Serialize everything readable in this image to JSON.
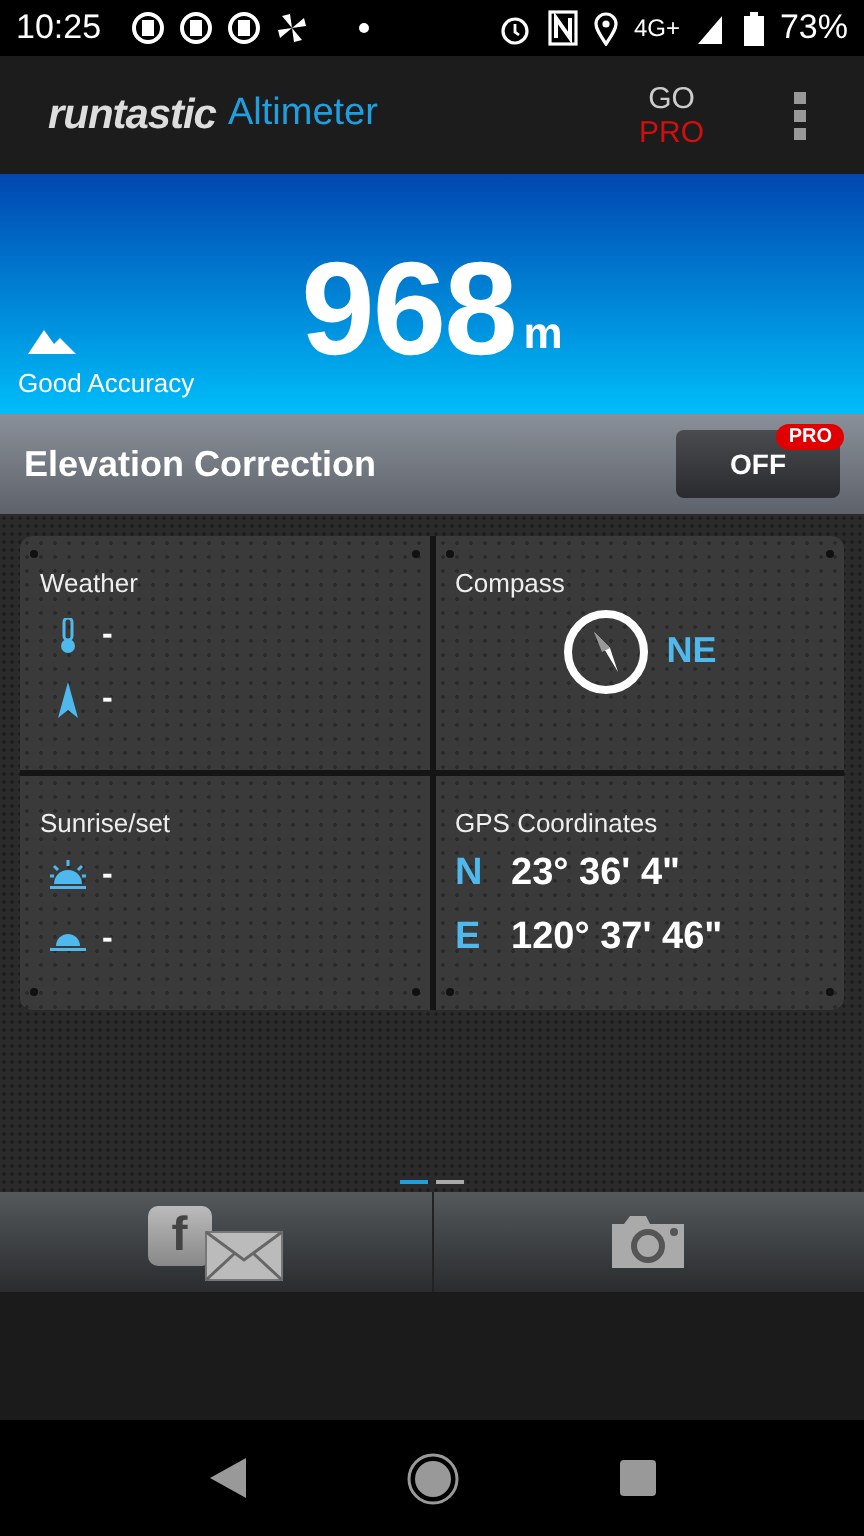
{
  "status_bar": {
    "time": "10:25",
    "network": "4G+",
    "battery": "73%"
  },
  "app_bar": {
    "brand": "runtastic",
    "product": "Altimeter",
    "go": "GO",
    "pro": "PRO"
  },
  "altitude": {
    "value": "968",
    "unit": "m",
    "accuracy": "Good Accuracy"
  },
  "elevation_correction": {
    "label": "Elevation Correction",
    "toggle": "OFF",
    "on": false,
    "badge": "PRO"
  },
  "tiles": [
    {
      "kind": "weather",
      "title": "Weather",
      "rows": [
        {
          "kind": "temperature",
          "value": "-"
        },
        {
          "kind": "wind",
          "value": "-"
        }
      ]
    },
    {
      "kind": "compass",
      "title": "Compass",
      "direction": "NE"
    },
    {
      "kind": "sun",
      "title": "Sunrise/set",
      "rows": [
        {
          "kind": "sunrise",
          "value": "-"
        },
        {
          "kind": "sunset",
          "value": "-"
        }
      ]
    },
    {
      "kind": "gps",
      "title": "GPS Coordinates",
      "rows": [
        {
          "axis": "N",
          "value": "23° 36' 4\""
        },
        {
          "axis": "E",
          "value": "120° 37' 46\""
        }
      ]
    }
  ],
  "pages": [
    {
      "selected": true
    },
    {
      "selected": false
    }
  ],
  "share_bar": {
    "facebook_letter": "f"
  }
}
